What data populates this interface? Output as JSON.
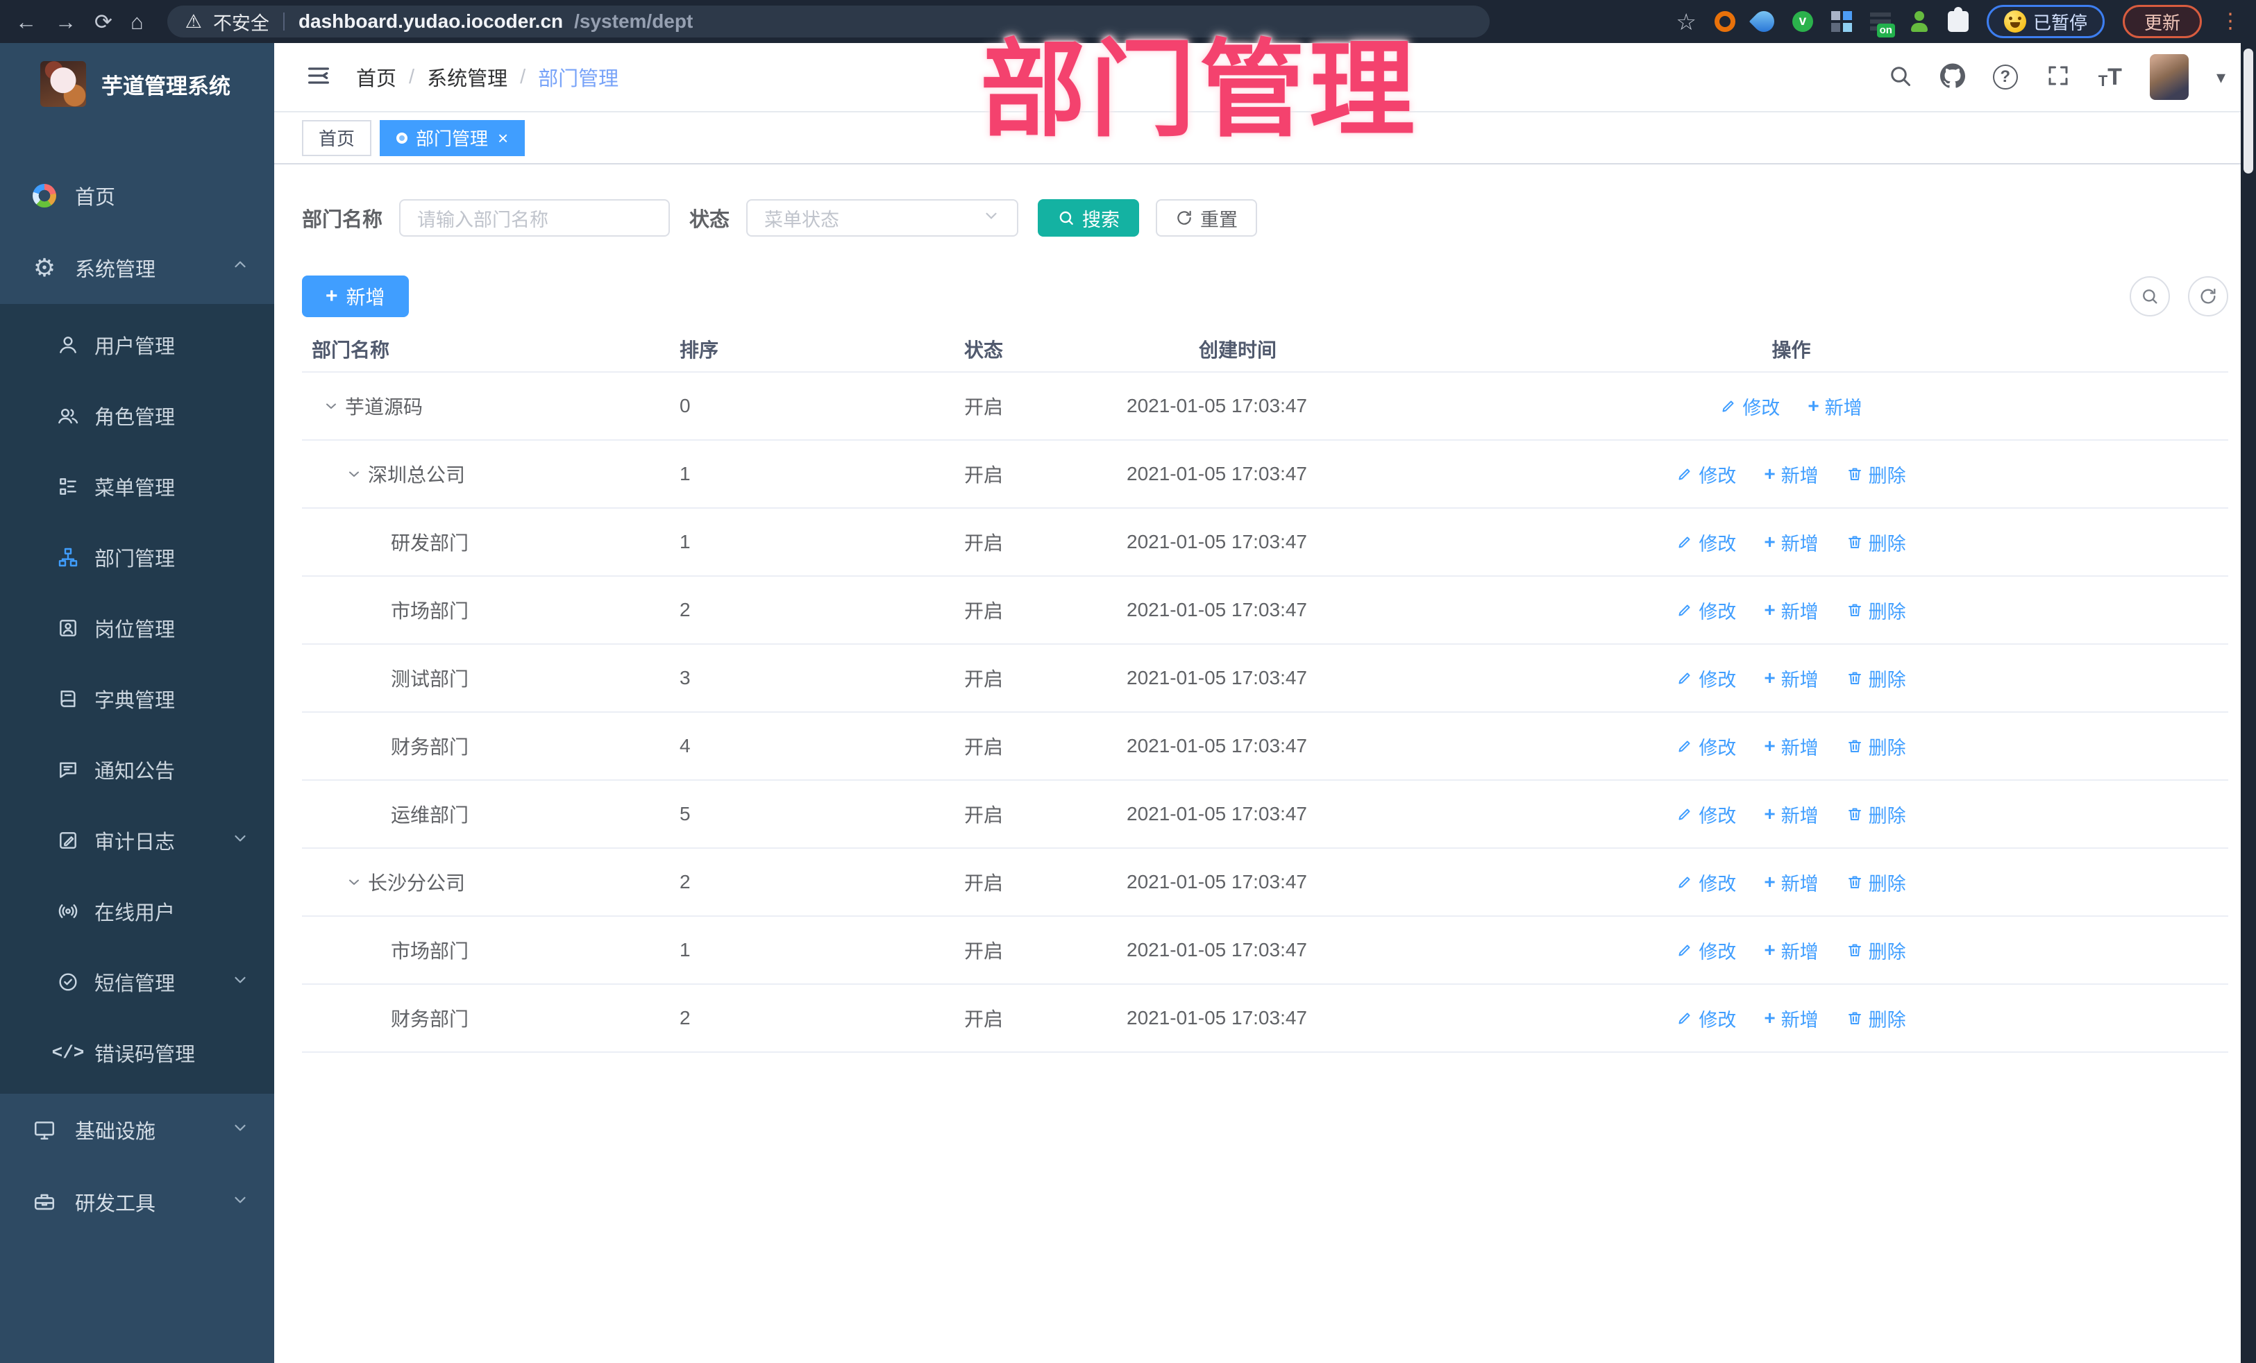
{
  "browser": {
    "security_label": "不安全",
    "url_host": "dashboard.yudao.iocoder.cn",
    "url_path": "/system/dept",
    "paused_label": "已暂停",
    "update_label": "更新"
  },
  "overlay_title": "部门管理",
  "sidebar": {
    "title": "芋道管理系统",
    "items_top": [
      {
        "label": "首页",
        "icon": "dashboard-icon"
      },
      {
        "label": "系统管理",
        "icon": "gear-icon",
        "chevron": "up"
      }
    ],
    "submenu": [
      {
        "label": "用户管理",
        "icon": "user-icon"
      },
      {
        "label": "角色管理",
        "icon": "users-icon"
      },
      {
        "label": "菜单管理",
        "icon": "menu-tree-icon"
      },
      {
        "label": "部门管理",
        "icon": "org-tree-icon",
        "active": true
      },
      {
        "label": "岗位管理",
        "icon": "badge-icon"
      },
      {
        "label": "字典管理",
        "icon": "book-icon"
      },
      {
        "label": "通知公告",
        "icon": "notice-icon"
      },
      {
        "label": "审计日志",
        "icon": "log-icon",
        "chevron": "down"
      },
      {
        "label": "在线用户",
        "icon": "online-icon"
      },
      {
        "label": "短信管理",
        "icon": "sms-icon",
        "chevron": "down"
      },
      {
        "label": "错误码管理",
        "icon": "code-icon"
      }
    ],
    "items_bottom": [
      {
        "label": "基础设施",
        "icon": "monitor-icon",
        "chevron": "down"
      },
      {
        "label": "研发工具",
        "icon": "toolbox-icon",
        "chevron": "down"
      }
    ]
  },
  "navbar": {
    "breadcrumb": [
      "首页",
      "系统管理",
      "部门管理"
    ]
  },
  "tabs": [
    {
      "label": "首页",
      "active": false,
      "closable": false
    },
    {
      "label": "部门管理",
      "active": true,
      "closable": true
    }
  ],
  "filter": {
    "name_label": "部门名称",
    "name_placeholder": "请输入部门名称",
    "status_label": "状态",
    "status_placeholder": "菜单状态",
    "search_label": "搜索",
    "reset_label": "重置"
  },
  "toolbar": {
    "add_label": "新增"
  },
  "table": {
    "columns": [
      "部门名称",
      "排序",
      "状态",
      "创建时间",
      "操作"
    ],
    "rows": [
      {
        "name": "芋道源码",
        "indent": 0,
        "expandable": true,
        "sort": "0",
        "status": "开启",
        "time": "2021-01-05 17:03:47",
        "actions": [
          {
            "label": "修改",
            "icon": "edit-icon"
          },
          {
            "label": "新增",
            "icon": "plus-icon"
          }
        ]
      },
      {
        "name": "深圳总公司",
        "indent": 1,
        "expandable": true,
        "sort": "1",
        "status": "开启",
        "time": "2021-01-05 17:03:47",
        "actions": [
          {
            "label": "修改",
            "icon": "edit-icon"
          },
          {
            "label": "新增",
            "icon": "plus-icon"
          },
          {
            "label": "删除",
            "icon": "delete-icon"
          }
        ]
      },
      {
        "name": "研发部门",
        "indent": 2,
        "expandable": false,
        "sort": "1",
        "status": "开启",
        "time": "2021-01-05 17:03:47",
        "actions": [
          {
            "label": "修改",
            "icon": "edit-icon"
          },
          {
            "label": "新增",
            "icon": "plus-icon"
          },
          {
            "label": "删除",
            "icon": "delete-icon"
          }
        ]
      },
      {
        "name": "市场部门",
        "indent": 2,
        "expandable": false,
        "sort": "2",
        "status": "开启",
        "time": "2021-01-05 17:03:47",
        "actions": [
          {
            "label": "修改",
            "icon": "edit-icon"
          },
          {
            "label": "新增",
            "icon": "plus-icon"
          },
          {
            "label": "删除",
            "icon": "delete-icon"
          }
        ]
      },
      {
        "name": "测试部门",
        "indent": 2,
        "expandable": false,
        "sort": "3",
        "status": "开启",
        "time": "2021-01-05 17:03:47",
        "actions": [
          {
            "label": "修改",
            "icon": "edit-icon"
          },
          {
            "label": "新增",
            "icon": "plus-icon"
          },
          {
            "label": "删除",
            "icon": "delete-icon"
          }
        ]
      },
      {
        "name": "财务部门",
        "indent": 2,
        "expandable": false,
        "sort": "4",
        "status": "开启",
        "time": "2021-01-05 17:03:47",
        "actions": [
          {
            "label": "修改",
            "icon": "edit-icon"
          },
          {
            "label": "新增",
            "icon": "plus-icon"
          },
          {
            "label": "删除",
            "icon": "delete-icon"
          }
        ]
      },
      {
        "name": "运维部门",
        "indent": 2,
        "expandable": false,
        "sort": "5",
        "status": "开启",
        "time": "2021-01-05 17:03:47",
        "actions": [
          {
            "label": "修改",
            "icon": "edit-icon"
          },
          {
            "label": "新增",
            "icon": "plus-icon"
          },
          {
            "label": "删除",
            "icon": "delete-icon"
          }
        ]
      },
      {
        "name": "长沙分公司",
        "indent": 1,
        "expandable": true,
        "sort": "2",
        "status": "开启",
        "time": "2021-01-05 17:03:47",
        "actions": [
          {
            "label": "修改",
            "icon": "edit-icon"
          },
          {
            "label": "新增",
            "icon": "plus-icon"
          },
          {
            "label": "删除",
            "icon": "delete-icon"
          }
        ]
      },
      {
        "name": "市场部门",
        "indent": 2,
        "expandable": false,
        "sort": "1",
        "status": "开启",
        "time": "2021-01-05 17:03:47",
        "actions": [
          {
            "label": "修改",
            "icon": "edit-icon"
          },
          {
            "label": "新增",
            "icon": "plus-icon"
          },
          {
            "label": "删除",
            "icon": "delete-icon"
          }
        ]
      },
      {
        "name": "财务部门",
        "indent": 2,
        "expandable": false,
        "sort": "2",
        "status": "开启",
        "time": "2021-01-05 17:03:47",
        "actions": [
          {
            "label": "修改",
            "icon": "edit-icon"
          },
          {
            "label": "新增",
            "icon": "plus-icon"
          },
          {
            "label": "删除",
            "icon": "delete-icon"
          }
        ]
      }
    ]
  },
  "colors": {
    "accent": "#409eff",
    "search_teal": "#14b2a2",
    "overlay_pink": "#f4426e",
    "sidebar_bg": "#2e4a63",
    "submenu_bg": "#223a4d",
    "chrome_bg": "#1d2634"
  }
}
